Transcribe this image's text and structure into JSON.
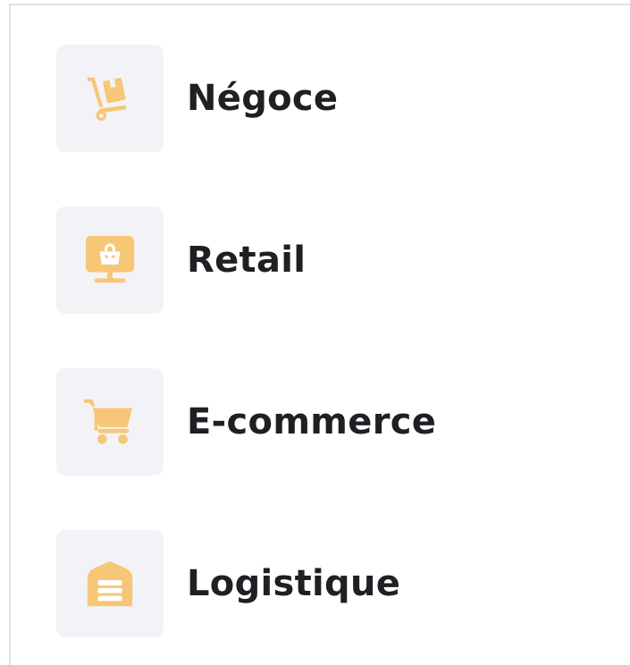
{
  "colors": {
    "icon_accent": "#f7c777",
    "tile_background": "#f3f3f7",
    "label_text": "#1f1f24"
  },
  "menu": {
    "items": [
      {
        "label": "Négoce",
        "icon": "hand-truck-box-icon"
      },
      {
        "label": "Retail",
        "icon": "monitor-shopping-bag-icon"
      },
      {
        "label": "E-commerce",
        "icon": "shopping-cart-icon"
      },
      {
        "label": "Logistique",
        "icon": "warehouse-icon"
      }
    ]
  }
}
